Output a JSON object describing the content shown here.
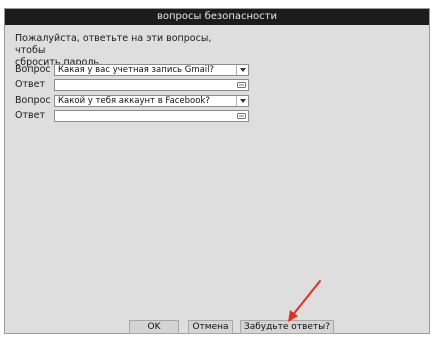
{
  "dialog": {
    "title": "вопросы безопасности",
    "instruction_line1": "Пожалуйста, ответьте на эти вопросы, чтобы",
    "instruction_line2": "сбросить пароль"
  },
  "form": {
    "question1_label": "Вопрос",
    "question1_value": "Какая у вас учетная запись Gmail?",
    "answer1_label": "Ответ",
    "answer1_value": "",
    "question2_label": "Вопрос",
    "question2_value": "Какой у тебя аккаунт в Facebook?",
    "answer2_label": "Ответ",
    "answer2_value": ""
  },
  "buttons": {
    "ok": "OK",
    "cancel": "Отмена",
    "forgot": "Забудьте ответы?"
  },
  "icons": {
    "dropdown": "chevron-down-icon",
    "answer_field": "keyboard-icon",
    "annotation": "red-arrow-icon"
  },
  "colors": {
    "titlebar": "#1c1c1c",
    "dialog_bg": "#dedede",
    "annotation_arrow": "#e03020"
  }
}
